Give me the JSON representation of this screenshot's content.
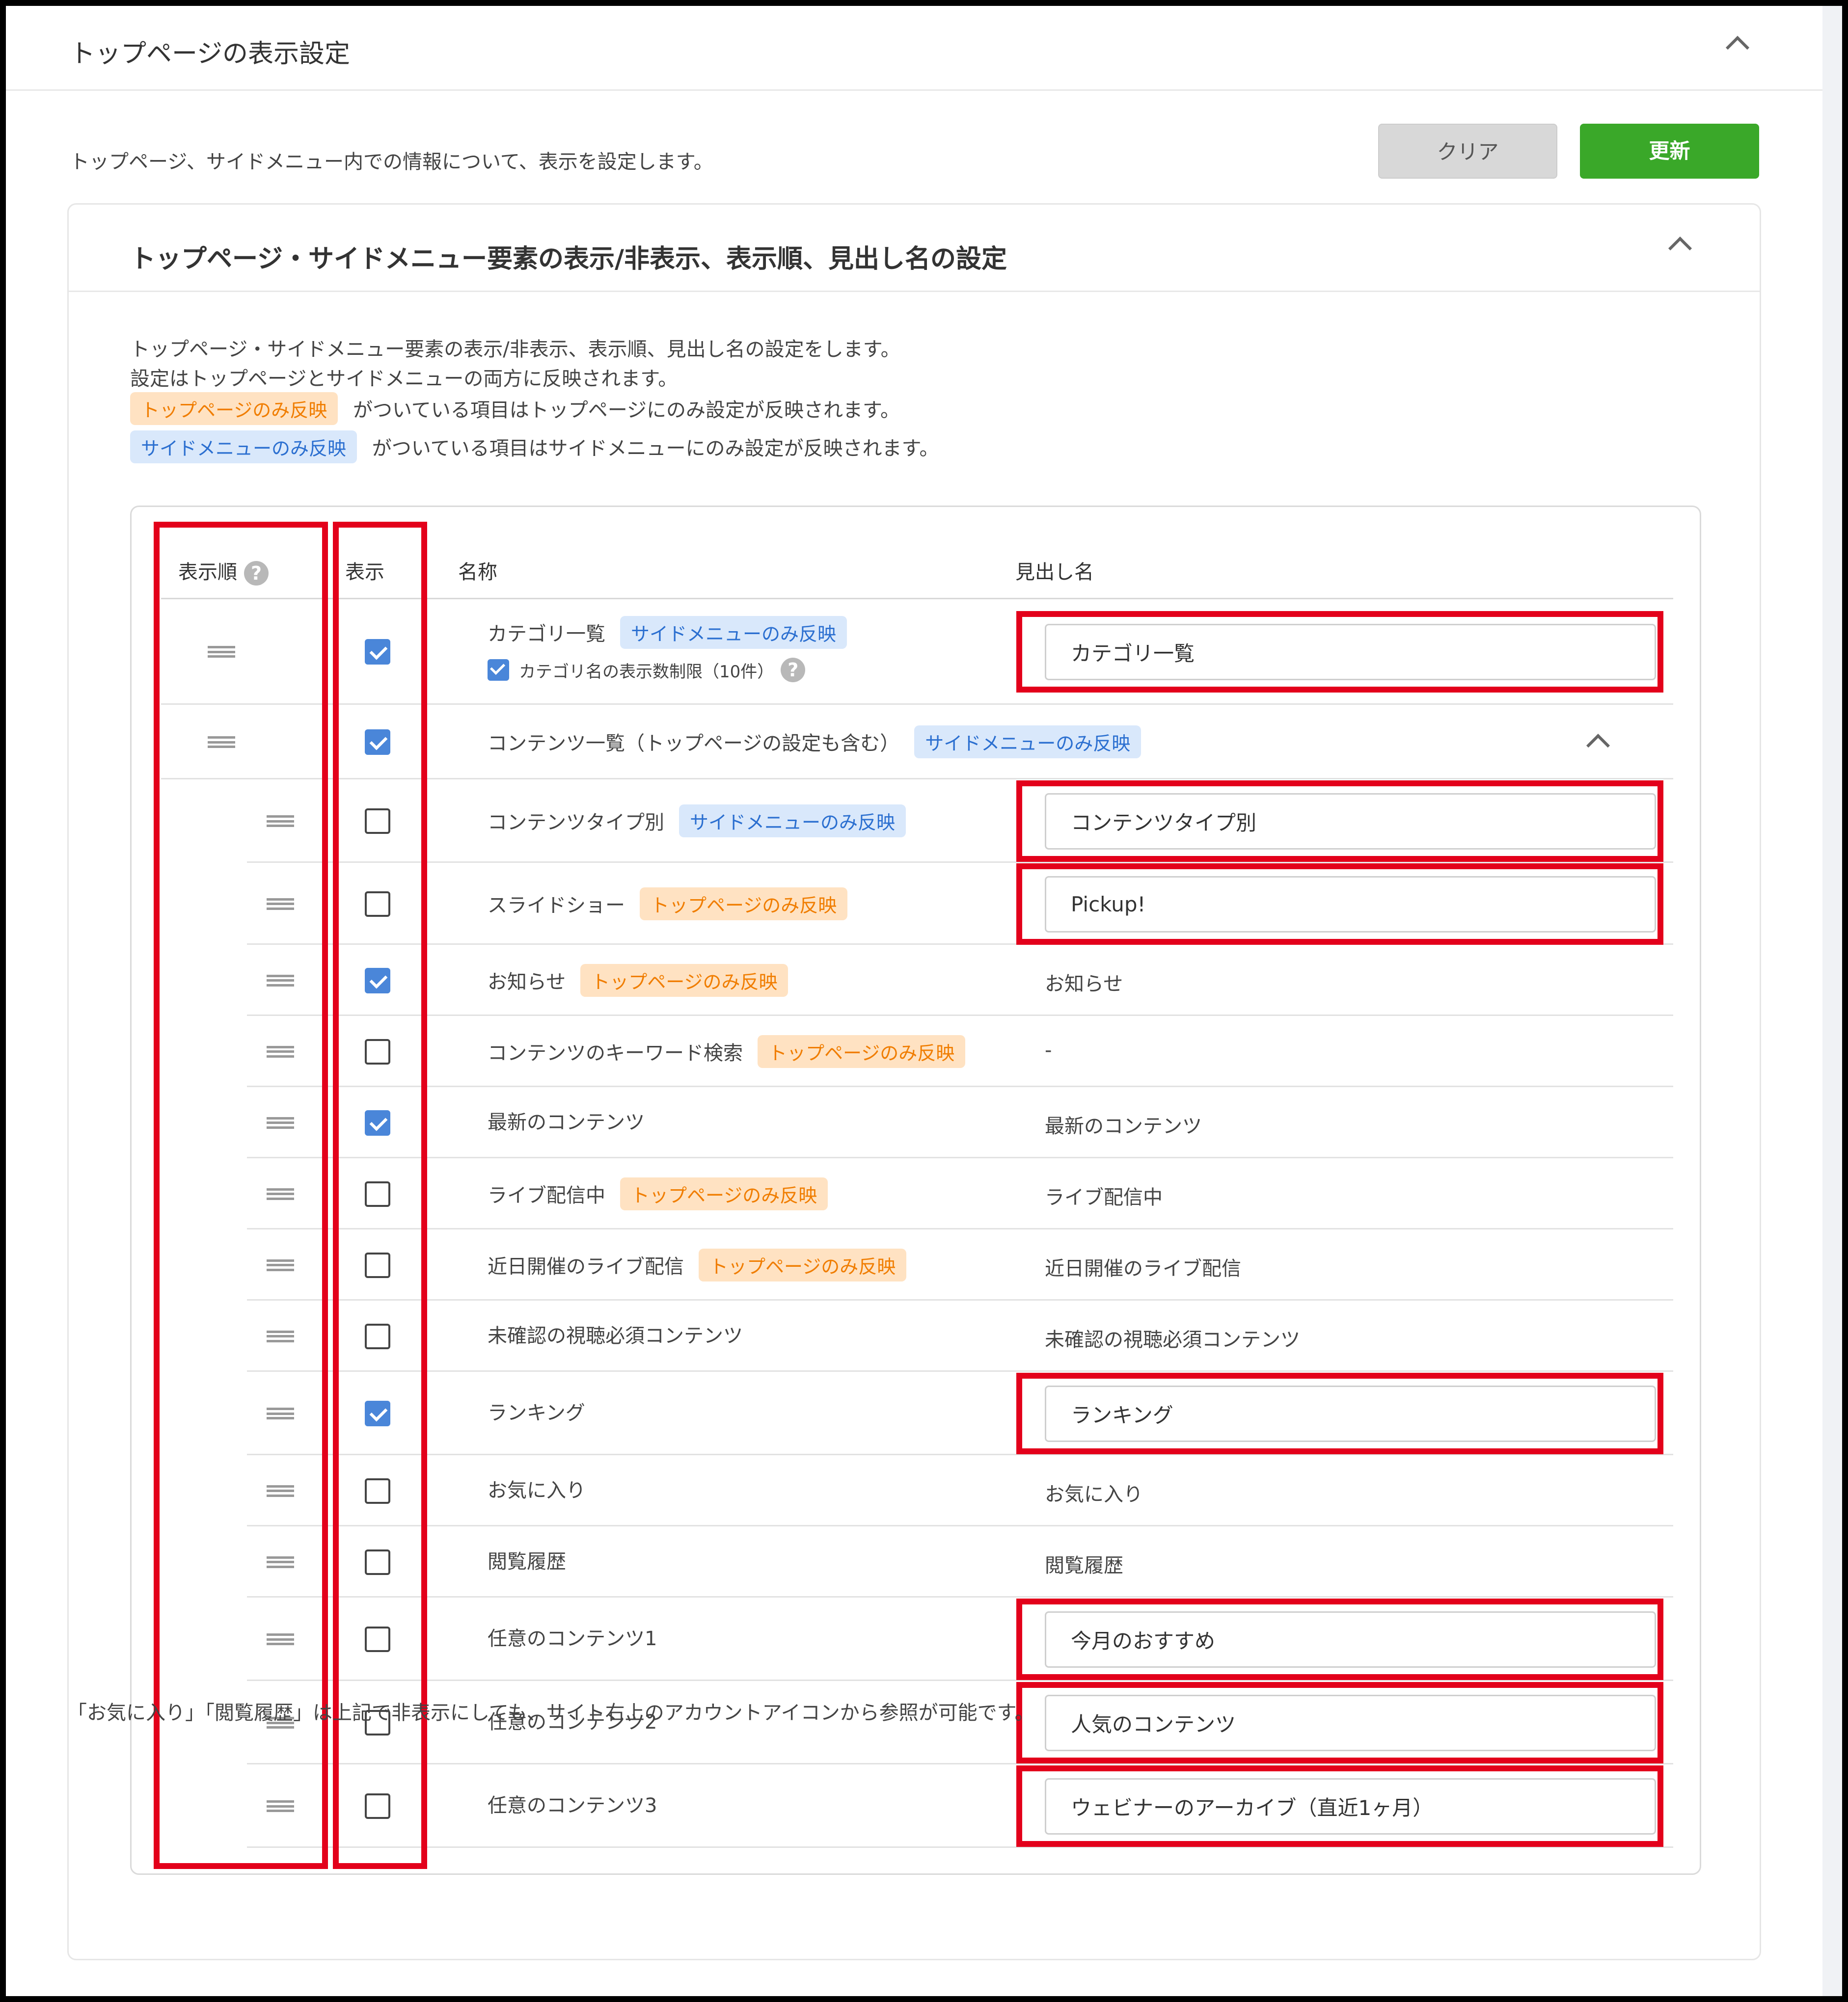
{
  "page": {
    "title": "トップページの表示設定",
    "description": "トップページ、サイドメニュー内での情報について、表示を設定します。",
    "clear_label": "クリア",
    "update_label": "更新"
  },
  "section": {
    "title": "トップページ・サイドメニュー要素の表示/非表示、表示順、見出し名の設定",
    "intro_line1": "トップページ・サイドメニュー要素の表示/非表示、表示順、見出し名の設定をします。",
    "intro_line2": "設定はトップページとサイドメニューの両方に反映されます。",
    "top_only_badge": "トップページのみ反映",
    "top_only_note": "がついている項目はトップページにのみ設定が反映されます。",
    "side_only_badge": "サイドメニューのみ反映",
    "side_only_note": "がついている項目はサイドメニューにのみ設定が反映されます。",
    "footnote": "「お気に入り」「閲覧履歴」は上記で非表示にしても、サイト右上のアカウントアイコンから参照が可能です。"
  },
  "table": {
    "headers": {
      "order": "表示順",
      "help": "?",
      "display": "表示",
      "name": "名称",
      "heading": "見出し名"
    },
    "rows": [
      {
        "name": "カテゴリ一覧",
        "badge": "サイドメニューのみ反映",
        "badge_type": "blue",
        "checked": true,
        "heading": "カテゴリ一覧",
        "heading_editable": true,
        "sub_option": {
          "label": "カテゴリ名の表示数制限（10件）",
          "checked": true,
          "help": "?"
        }
      },
      {
        "name": "コンテンツ一覧（トップページの設定も含む）",
        "badge": "サイドメニューのみ反映",
        "badge_type": "blue",
        "checked": true,
        "heading": "",
        "group": true
      },
      {
        "name": "コンテンツタイプ別",
        "badge": "サイドメニューのみ反映",
        "badge_type": "blue",
        "checked": false,
        "heading": "コンテンツタイプ別",
        "heading_editable": true
      },
      {
        "name": "スライドショー",
        "badge": "トップページのみ反映",
        "badge_type": "orange",
        "checked": false,
        "heading": "Pickup!",
        "heading_editable": true
      },
      {
        "name": "お知らせ",
        "badge": "トップページのみ反映",
        "badge_type": "orange",
        "checked": true,
        "heading": "お知らせ",
        "heading_editable": false
      },
      {
        "name": "コンテンツのキーワード検索",
        "badge": "トップページのみ反映",
        "badge_type": "orange",
        "checked": false,
        "heading": "-",
        "heading_editable": false
      },
      {
        "name": "最新のコンテンツ",
        "badge": "",
        "checked": true,
        "heading": "最新のコンテンツ",
        "heading_editable": false
      },
      {
        "name": "ライブ配信中",
        "badge": "トップページのみ反映",
        "badge_type": "orange",
        "checked": false,
        "heading": "ライブ配信中",
        "heading_editable": false
      },
      {
        "name": "近日開催のライブ配信",
        "badge": "トップページのみ反映",
        "badge_type": "orange",
        "checked": false,
        "heading": "近日開催のライブ配信",
        "heading_editable": false
      },
      {
        "name": "未確認の視聴必須コンテンツ",
        "badge": "",
        "checked": false,
        "heading": "未確認の視聴必須コンテンツ",
        "heading_editable": false
      },
      {
        "name": "ランキング",
        "badge": "",
        "checked": true,
        "heading": "ランキング",
        "heading_editable": true
      },
      {
        "name": "お気に入り",
        "badge": "",
        "checked": false,
        "heading": "お気に入り",
        "heading_editable": false
      },
      {
        "name": "閲覧履歴",
        "badge": "",
        "checked": false,
        "heading": "閲覧履歴",
        "heading_editable": false
      },
      {
        "name": "任意のコンテンツ1",
        "badge": "",
        "checked": false,
        "heading": "今月のおすすめ",
        "heading_editable": true
      },
      {
        "name": "任意のコンテンツ2",
        "badge": "",
        "checked": false,
        "heading": "人気のコンテンツ",
        "heading_editable": true
      },
      {
        "name": "任意のコンテンツ3",
        "badge": "",
        "checked": false,
        "heading": "ウェビナーのアーカイブ（直近1ヶ月）",
        "heading_editable": true
      }
    ]
  },
  "colors": {
    "accent_green": "#3aa829",
    "checkbox_blue": "#4a86d9",
    "highlight_red": "#e3001b",
    "badge_orange": "#f07d00",
    "badge_blue": "#2b6fd0"
  },
  "icons": {
    "collapse": "chevron-up-icon",
    "drag": "drag-handle-icon",
    "help": "help-circle-icon"
  }
}
